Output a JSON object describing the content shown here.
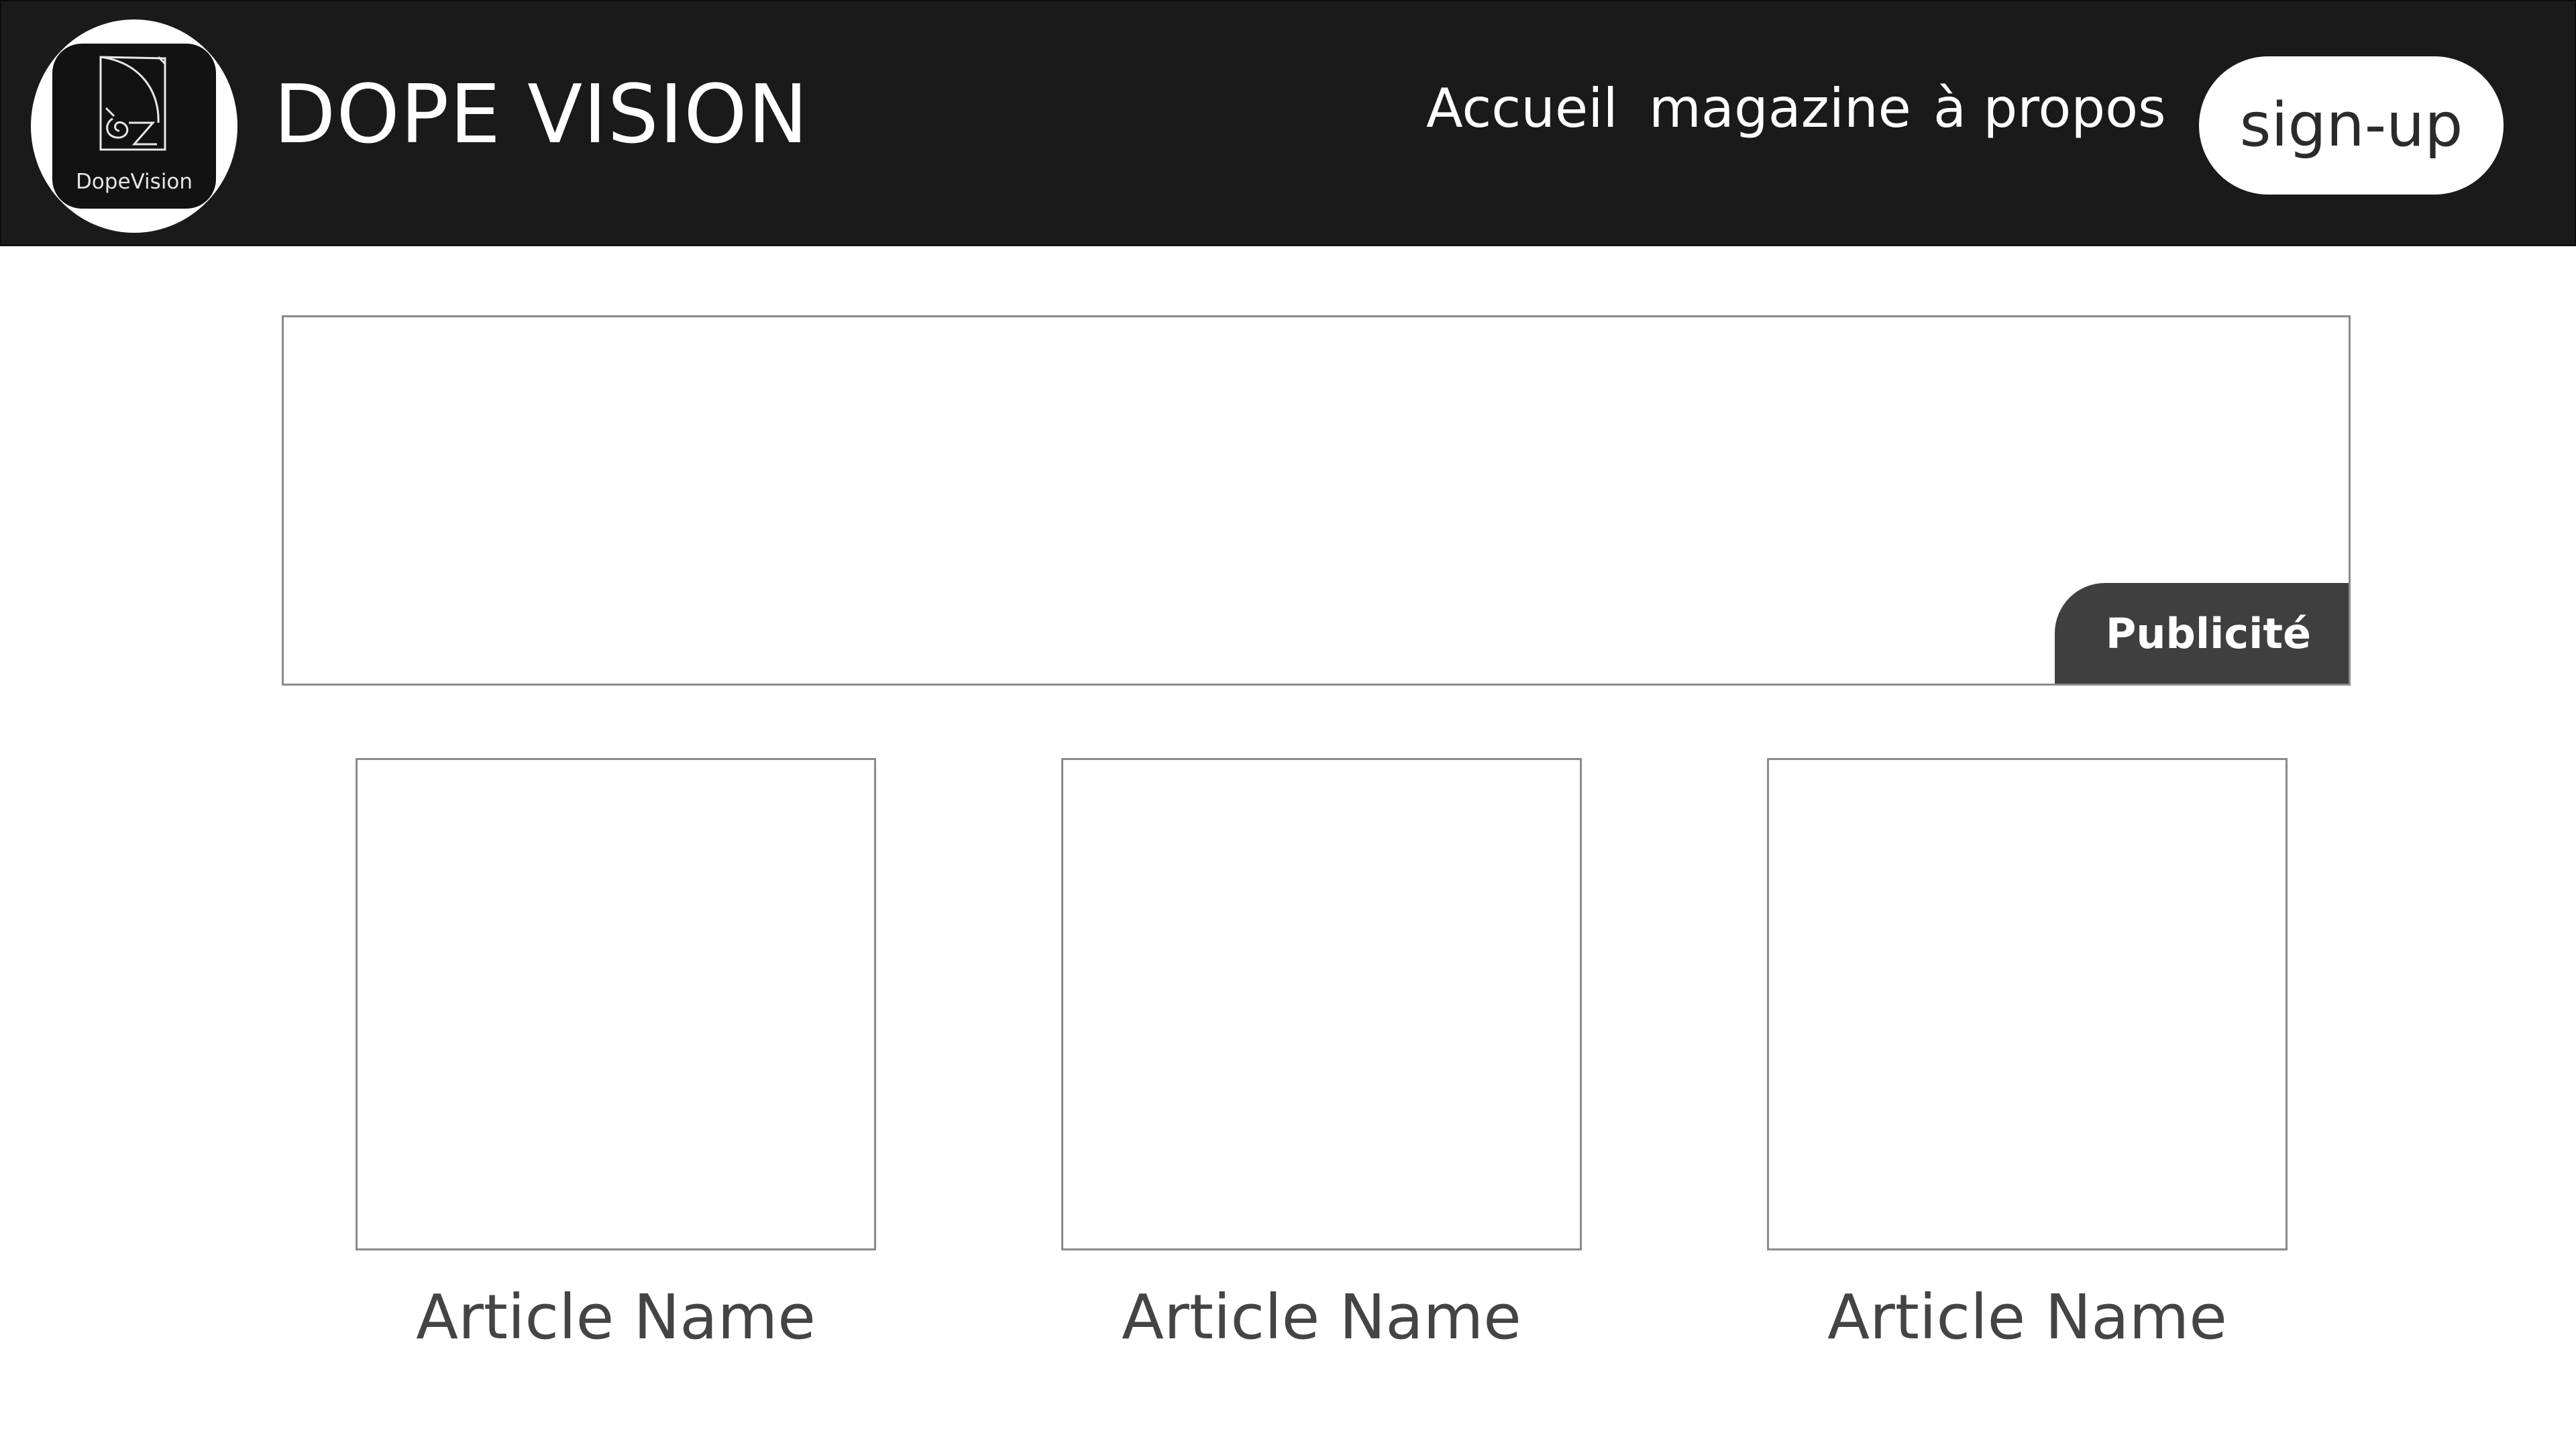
{
  "header": {
    "logo_text": "DopeVision",
    "brand_title": "DOPE VISION",
    "nav": {
      "accueil": "Accueil",
      "magazine": "magazine",
      "apropos": "à propos"
    },
    "signup_label": "sign-up"
  },
  "ad": {
    "label": "Publicité"
  },
  "articles": [
    {
      "title": "Article Name"
    },
    {
      "title": "Article Name"
    },
    {
      "title": "Article Name"
    }
  ],
  "colors": {
    "header_bg": "#1b1a1a",
    "ad_label_bg": "#3f3f3f",
    "card_border": "#8a8a8a",
    "article_text": "#444444"
  },
  "icons": {
    "logo": "dopevision-logo-icon"
  }
}
